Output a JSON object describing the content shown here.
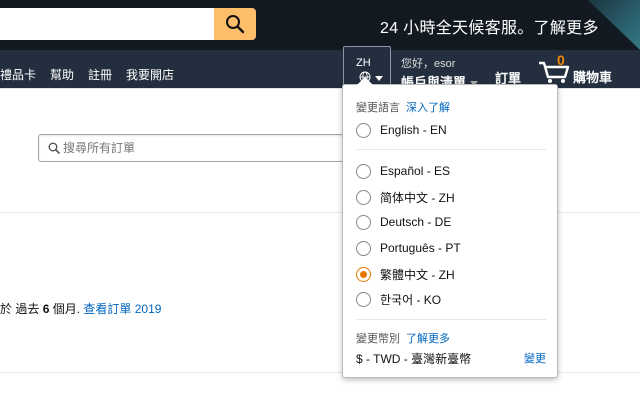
{
  "header": {
    "promo_text": "24 小時全天候客服。了解更多",
    "search_icon": "search-icon"
  },
  "nav": {
    "links": [
      "禮品卡",
      "幫助",
      "註冊",
      "我要開店"
    ],
    "lang_code": "ZH",
    "greeting": "您好，esor",
    "account_label": "帳戶與清單",
    "orders_label": "訂單",
    "cart_count": "0",
    "cart_label": "購物車"
  },
  "page": {
    "order_search_placeholder": "搜尋所有訂單",
    "past_orders_prefix": "於 過去",
    "past_orders_count": "6",
    "past_orders_suffix": " 個月. ",
    "past_orders_link": "查看訂單 2019"
  },
  "language_flyout": {
    "title": "變更語言",
    "learn_more": "深入了解",
    "options": [
      {
        "label": "English - EN",
        "checked": false
      },
      {
        "label": "Español - ES",
        "checked": false
      },
      {
        "label": "简体中文 - ZH",
        "checked": false
      },
      {
        "label": "Deutsch - DE",
        "checked": false
      },
      {
        "label": "Português - PT",
        "checked": false
      },
      {
        "label": "繁體中文 - ZH",
        "checked": true
      },
      {
        "label": "한국어 - KO",
        "checked": false
      }
    ],
    "currency_title": "變更幣別",
    "currency_learn_more": "了解更多",
    "currency_value": "$ - TWD - 臺灣新臺幣",
    "currency_change": "變更"
  },
  "colors": {
    "header_bg": "#131921",
    "nav_bg": "#232f3e",
    "search_button": "#febd69",
    "accent_orange": "#e77600",
    "link_blue": "#0066c0"
  }
}
